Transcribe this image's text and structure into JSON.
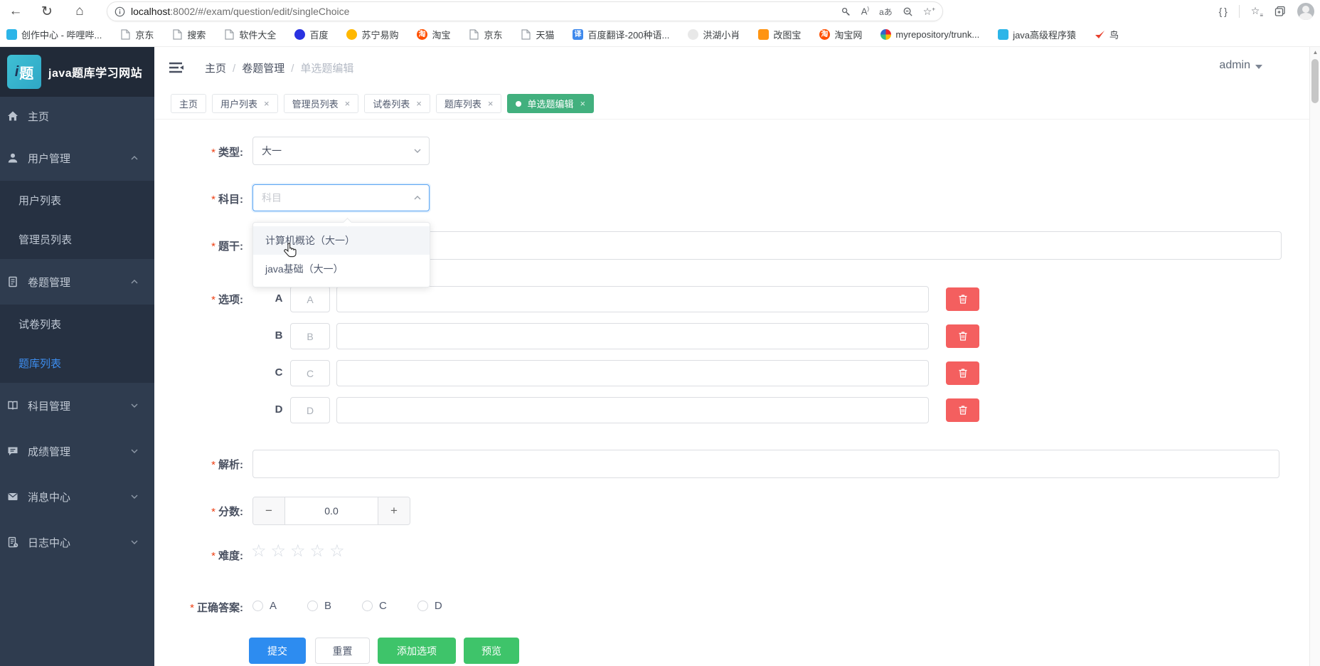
{
  "colors": {
    "primary": "#2d8cf0",
    "success": "#3ec46a",
    "danger": "#f45f5f",
    "active_tab": "#42b07e",
    "sidebar_bg": "#2f3c4f",
    "sidebar_sub_bg": "#263142",
    "active_menu_text": "#3d8ef0"
  },
  "browser": {
    "url_host": "localhost",
    "url_rest": ":8002/#/exam/question/edit/singleChoice",
    "nav_icons": [
      "back-icon",
      "refresh-icon",
      "home-icon"
    ],
    "pill_icons": [
      "key-icon",
      "read-aloud-icon",
      "translate-icon",
      "zoom-out-icon",
      "favorite-add-icon"
    ],
    "right_icons": [
      "extensions-icon",
      "favorites-bar-icon",
      "collections-icon",
      "profile-avatar"
    ],
    "bookmarks": [
      {
        "name": "bilibili-creator",
        "label": "创作中心 - 哔哩哔...",
        "icon": "bilibili-icon",
        "shape": "square",
        "color": "#2cb5e8",
        "glyph": ""
      },
      {
        "name": "jd-1",
        "label": "京东",
        "icon": "page-icon",
        "shape": "page"
      },
      {
        "name": "search",
        "label": "搜索",
        "icon": "page-icon",
        "shape": "page"
      },
      {
        "name": "software",
        "label": "软件大全",
        "icon": "page-icon",
        "shape": "page"
      },
      {
        "name": "baidu",
        "label": "百度",
        "icon": "baidu-icon",
        "shape": "circle",
        "color": "#2932e1",
        "glyph": ""
      },
      {
        "name": "suning",
        "label": "苏宁易购",
        "icon": "suning-icon",
        "shape": "circle",
        "color": "#ffb800",
        "glyph": ""
      },
      {
        "name": "taobao",
        "label": "淘宝",
        "icon": "taobao-icon",
        "shape": "circle",
        "color": "#ff5000",
        "glyph": "淘"
      },
      {
        "name": "jd-2",
        "label": "京东",
        "icon": "page-icon",
        "shape": "page"
      },
      {
        "name": "tmall",
        "label": "天猫",
        "icon": "page-icon",
        "shape": "page"
      },
      {
        "name": "baidu-translate",
        "label": "百度翻译-200种语...",
        "icon": "translate-icon",
        "shape": "square",
        "color": "#3f89ec",
        "glyph": "译"
      },
      {
        "name": "honghu",
        "label": "洪湖小肖",
        "icon": "rooster-icon",
        "shape": "circle",
        "color": "#e8e8e8",
        "glyph": ""
      },
      {
        "name": "gaitubao",
        "label": "改图宝",
        "icon": "gaitubao-icon",
        "shape": "square",
        "color": "#ff9412",
        "glyph": ""
      },
      {
        "name": "taobao-web",
        "label": "淘宝网",
        "icon": "taobao-icon",
        "shape": "circle",
        "color": "#ff5000",
        "glyph": "淘"
      },
      {
        "name": "myrepository",
        "label": "myrepository/trunk...",
        "icon": "repo-swirl-icon",
        "shape": "swirl"
      },
      {
        "name": "java-programmer",
        "label": "java高级程序猿",
        "icon": "bilibili-icon",
        "shape": "square",
        "color": "#2cb5e8",
        "glyph": ""
      },
      {
        "name": "bird",
        "label": "鸟",
        "icon": "bird-icon",
        "shape": "bird",
        "color": "#e8402d"
      }
    ]
  },
  "sidebar": {
    "logo_text": "i题",
    "title": "java题库学习网站",
    "items": [
      {
        "name": "home",
        "label": "主页",
        "icon": "home-icon",
        "chevron": null,
        "children": []
      },
      {
        "name": "user-mgmt",
        "label": "用户管理",
        "icon": "user-icon",
        "chevron": "up",
        "children": [
          {
            "name": "user-list",
            "label": "用户列表",
            "active": false
          },
          {
            "name": "admin-list",
            "label": "管理员列表",
            "active": false
          }
        ]
      },
      {
        "name": "paper-mgmt",
        "label": "卷题管理",
        "icon": "paper-icon",
        "chevron": "up",
        "children": [
          {
            "name": "exam-list",
            "label": "试卷列表",
            "active": false
          },
          {
            "name": "question-bank-list",
            "label": "题库列表",
            "active": true
          }
        ]
      },
      {
        "name": "subject-mgmt",
        "label": "科目管理",
        "icon": "book-icon",
        "chevron": "down",
        "children": []
      },
      {
        "name": "score-mgmt",
        "label": "成绩管理",
        "icon": "chat-icon",
        "chevron": "down",
        "children": []
      },
      {
        "name": "message-center",
        "label": "消息中心",
        "icon": "mail-icon",
        "chevron": "down",
        "children": []
      },
      {
        "name": "log-center",
        "label": "日志中心",
        "icon": "log-icon",
        "chevron": "down",
        "children": []
      }
    ]
  },
  "header": {
    "breadcrumb": [
      "主页",
      "卷题管理",
      "单选题编辑"
    ],
    "separator": "/",
    "user": "admin"
  },
  "tabs": [
    {
      "label": "主页",
      "closable": false,
      "active": false
    },
    {
      "label": "用户列表",
      "closable": true,
      "active": false
    },
    {
      "label": "管理员列表",
      "closable": true,
      "active": false
    },
    {
      "label": "试卷列表",
      "closable": true,
      "active": false
    },
    {
      "label": "题库列表",
      "closable": true,
      "active": false
    },
    {
      "label": "单选题编辑",
      "closable": true,
      "active": true
    }
  ],
  "form": {
    "required_marker": "*",
    "type": {
      "label": "类型:",
      "value": "大一"
    },
    "subject": {
      "label": "科目:",
      "placeholder": "科目",
      "dropdown": [
        {
          "label": "计算机概论（大一）",
          "hover": true
        },
        {
          "label": "java基础（大一）",
          "hover": false
        }
      ]
    },
    "stem": {
      "label": "题干:",
      "value": ""
    },
    "options": {
      "label": "选项:",
      "rows": [
        {
          "letter": "A",
          "prefix": "A",
          "value": ""
        },
        {
          "letter": "B",
          "prefix": "B",
          "value": ""
        },
        {
          "letter": "C",
          "prefix": "C",
          "value": ""
        },
        {
          "letter": "D",
          "prefix": "D",
          "value": ""
        }
      ]
    },
    "analysis": {
      "label": "解析:",
      "value": ""
    },
    "score": {
      "label": "分数:",
      "value": "0.0",
      "minus": "−",
      "plus": "+"
    },
    "difficulty": {
      "label": "难度:",
      "star_count": 5,
      "star_char": "☆",
      "selected": 0
    },
    "answer": {
      "label": "正确答案:",
      "choices": [
        "A",
        "B",
        "C",
        "D"
      ],
      "selected": null
    },
    "buttons": {
      "submit": "提交",
      "reset": "重置",
      "add_option": "添加选项",
      "preview": "预览"
    }
  }
}
